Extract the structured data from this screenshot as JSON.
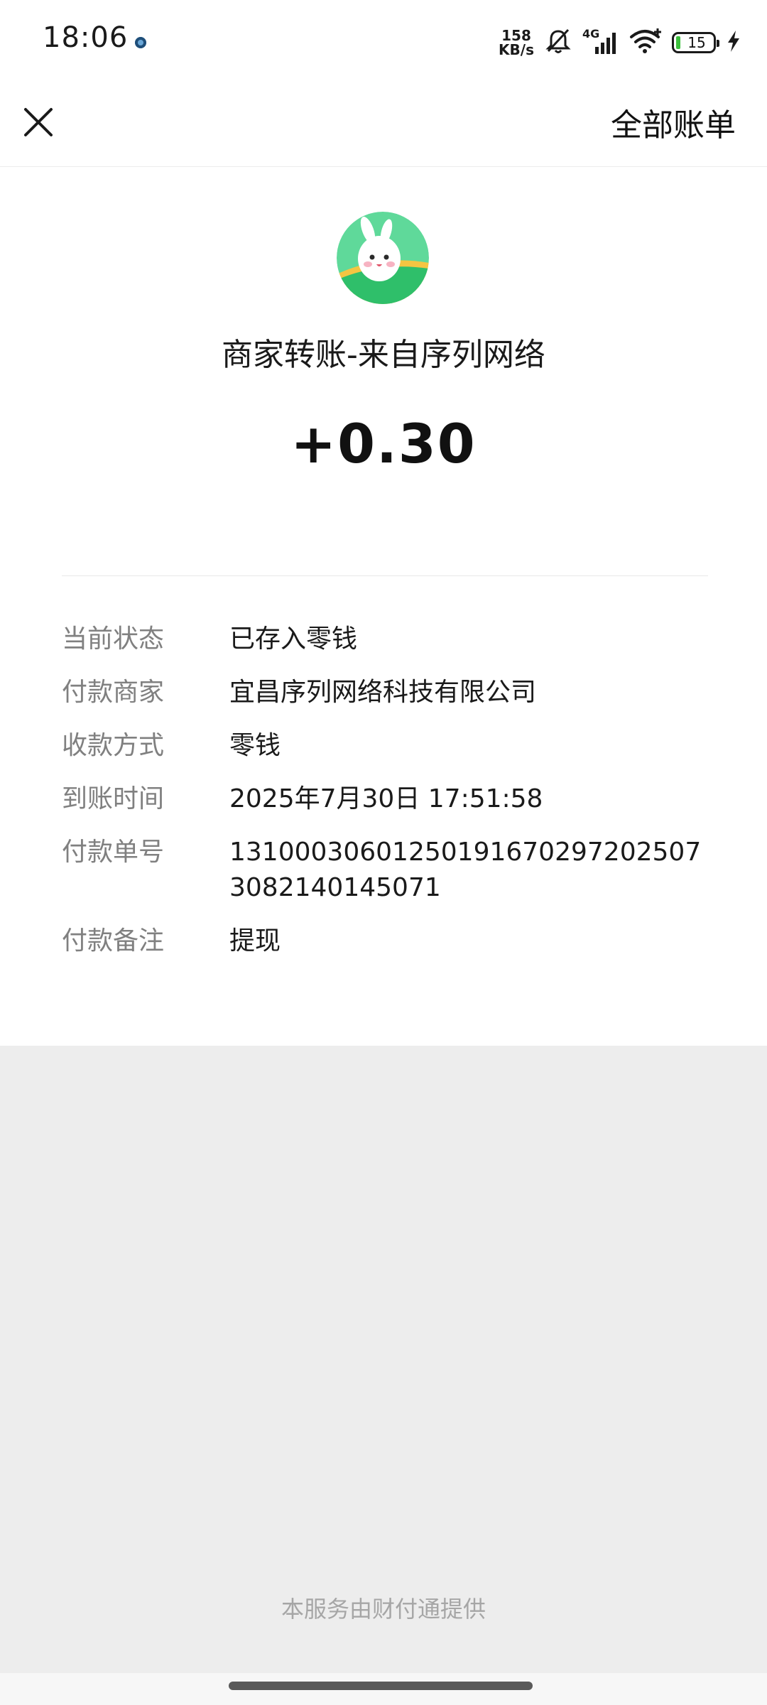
{
  "status_bar": {
    "time": "18:06",
    "net_speed_value": "158",
    "net_speed_unit": "KB/s",
    "network_type": "4G",
    "battery_level": "15",
    "icons": [
      "camera-dot-icon",
      "bell-off-icon",
      "signal-icon",
      "wifi-icon",
      "battery-icon",
      "charging-bolt-icon"
    ]
  },
  "nav": {
    "close_icon": "close-icon",
    "all_bills_label": "全部账单"
  },
  "transaction": {
    "avatar_icon": "merchant-avatar-icon",
    "title": "商家转账-来自序列网络",
    "amount": "+0.30",
    "details": [
      {
        "label": "当前状态",
        "value": "已存入零钱"
      },
      {
        "label": "付款商家",
        "value": "宜昌序列网络科技有限公司"
      },
      {
        "label": "收款方式",
        "value": "零钱"
      },
      {
        "label": "到账时间",
        "value": "2025年7月30日 17:51:58"
      },
      {
        "label": "付款单号",
        "value": "131000306012501916702972025073082140145071"
      },
      {
        "label": "付款备注",
        "value": "提现"
      }
    ]
  },
  "footer": {
    "service_text": "本服务由财付通提供"
  },
  "colors": {
    "page_background": "#ededed",
    "card_background": "#ffffff",
    "label_gray": "#808080",
    "avatar_green": "#3fcb76",
    "battery_green": "#3cc03c"
  }
}
